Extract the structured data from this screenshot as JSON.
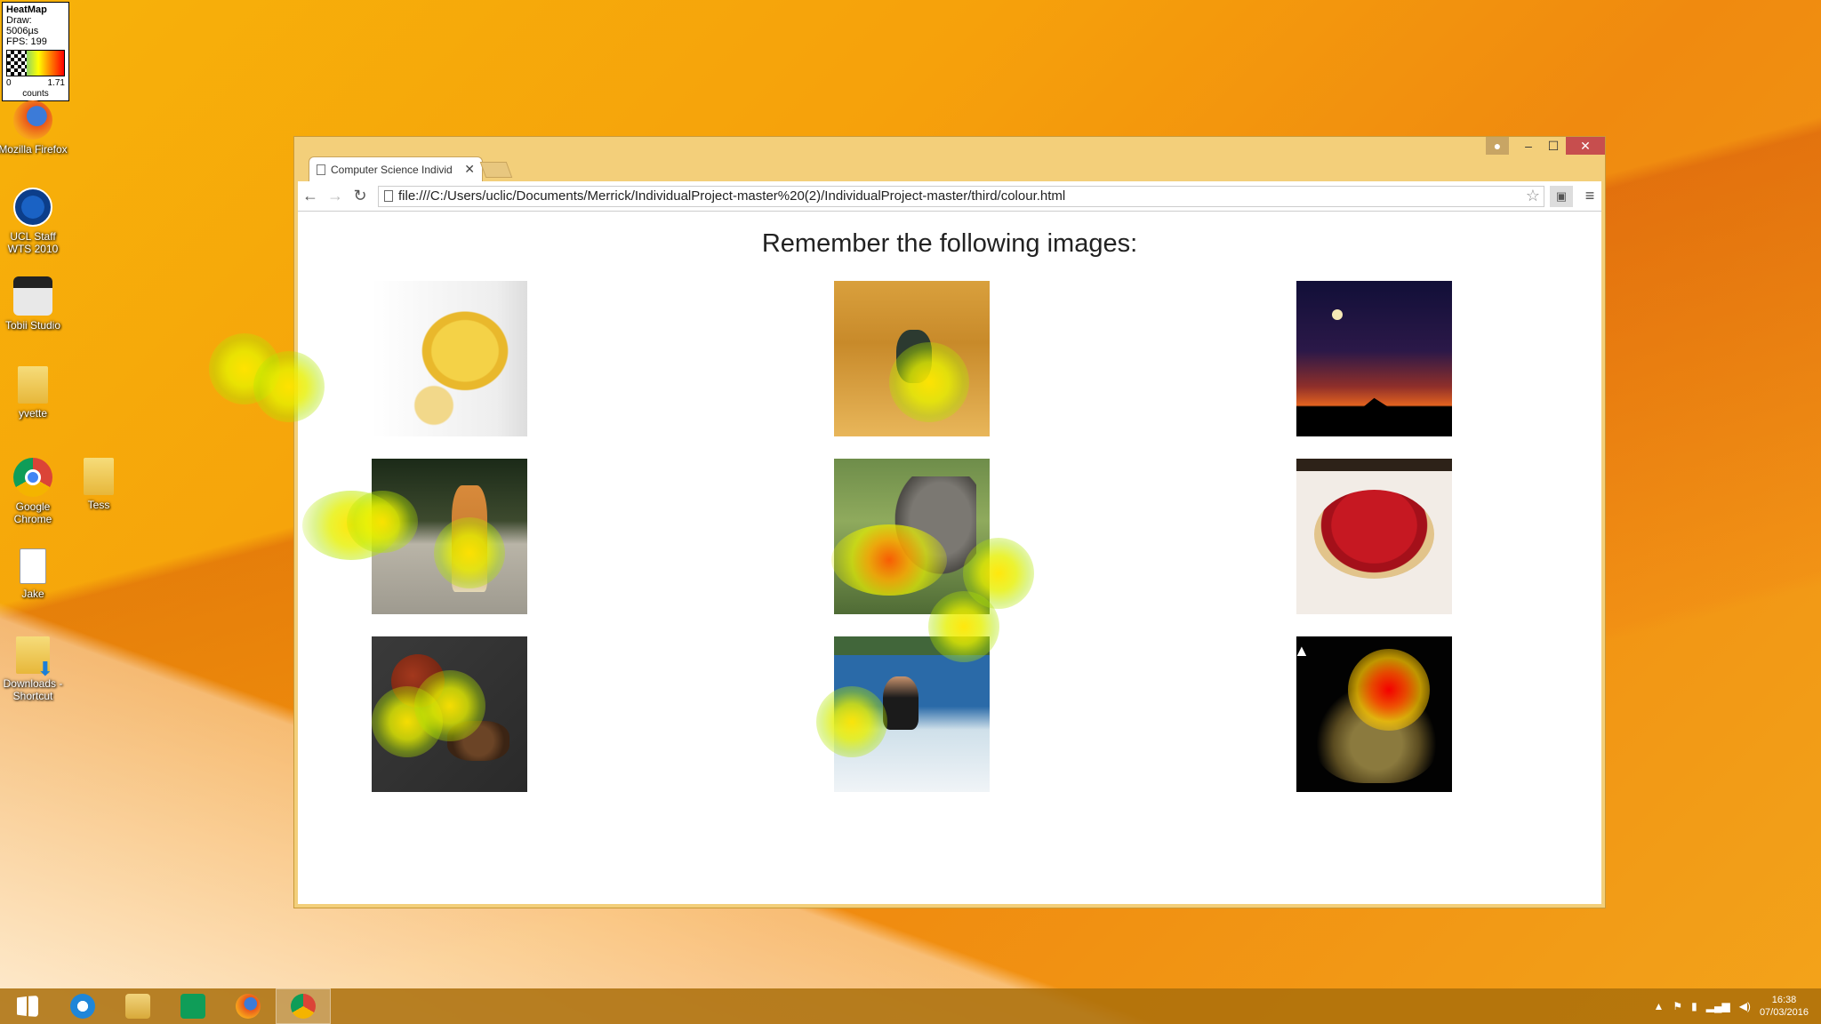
{
  "heatmap_legend": {
    "title": "HeatMap",
    "draw": "Draw: 5006µs",
    "fps": "FPS: 199",
    "min": "0",
    "max": "1.71",
    "units": "counts"
  },
  "desktop_icons": [
    {
      "label": "Mozilla Firefox",
      "icon": "firefox-icon"
    },
    {
      "label": "UCL Staff WTS 2010",
      "icon": "remote-desktop-icon"
    },
    {
      "label": "Tobii Studio",
      "icon": "tobii-studio-icon"
    },
    {
      "label": "yvette",
      "icon": "folder-icon"
    },
    {
      "label": "Google Chrome",
      "icon": "chrome-icon"
    },
    {
      "label": "Tess",
      "icon": "folder-icon"
    },
    {
      "label": "Jake",
      "icon": "document-icon"
    },
    {
      "label": "Downloads - Shortcut",
      "icon": "downloads-folder-icon"
    }
  ],
  "browser": {
    "tab_title": "Computer Science Individ",
    "url": "file:///C:/Users/uclic/Documents/Merrick/IndividualProject-master%20(2)/IndividualProject-master/third/colour.html",
    "window_buttons": {
      "minimize": "–",
      "maximize": "☐",
      "close": "✕"
    }
  },
  "page": {
    "heading": "Remember the following images:",
    "images": [
      {
        "subject": "bananas"
      },
      {
        "subject": "desert-boots"
      },
      {
        "subject": "night-sunset"
      },
      {
        "subject": "toy-giraffe"
      },
      {
        "subject": "donkey"
      },
      {
        "subject": "strawberry-tart"
      },
      {
        "subject": "coffee-beans"
      },
      {
        "subject": "jet-ski"
      },
      {
        "subject": "jewellery"
      }
    ]
  },
  "taskbar": {
    "items": [
      "start",
      "internet-explorer",
      "file-explorer",
      "store",
      "firefox",
      "chrome"
    ],
    "active": "chrome",
    "clock_time": "16:38",
    "clock_date": "07/03/2016"
  },
  "colors": {
    "desktop": "#f6a10b",
    "heat_low": "#c8f000",
    "heat_mid": "#ffe600",
    "heat_high": "#f50000",
    "window_frame": "#f3cf7a",
    "close_button": "#c74e4e"
  }
}
